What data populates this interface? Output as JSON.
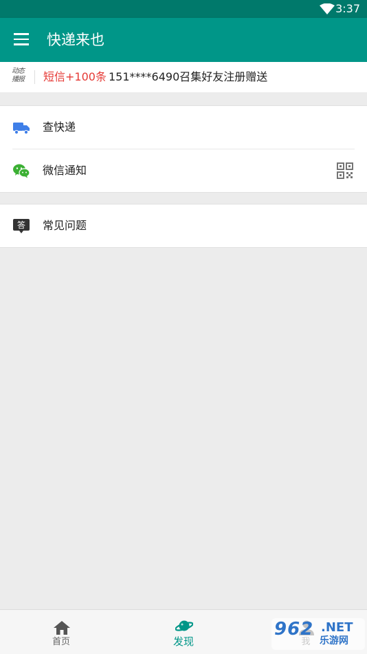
{
  "status_bar": {
    "time": "3:37",
    "wifi_icon": "wifi-icon"
  },
  "app_bar": {
    "title": "快递来也",
    "menu_icon": "menu-icon"
  },
  "broadcast": {
    "logo_text": [
      "动态",
      "播报"
    ],
    "tag": "短信+100条",
    "message": "151****6490召集好友注册赠送"
  },
  "menu_group_1": {
    "items": [
      {
        "label": "查快递",
        "icon": "truck-icon"
      },
      {
        "label": "微信通知",
        "icon": "wechat-icon",
        "action_icon": "qr-code-icon"
      }
    ]
  },
  "menu_group_2": {
    "items": [
      {
        "label": "常见问题",
        "icon": "faq-icon",
        "icon_glyph": "答"
      }
    ]
  },
  "bottom_nav": {
    "items": [
      {
        "label": "首页",
        "icon": "home-icon",
        "active": false
      },
      {
        "label": "发现",
        "icon": "planet-icon",
        "active": true
      },
      {
        "label": "我",
        "icon": "person-icon",
        "active": false
      }
    ]
  },
  "watermark": {
    "line1": "962",
    "line2": ".NET",
    "line3": "乐游网"
  },
  "colors": {
    "primary": "#009688",
    "primary_dark": "#00796b",
    "accent_red": "#e53935",
    "truck_blue": "#3f7fe8",
    "wechat_green": "#3cb034",
    "background": "#ececec"
  }
}
